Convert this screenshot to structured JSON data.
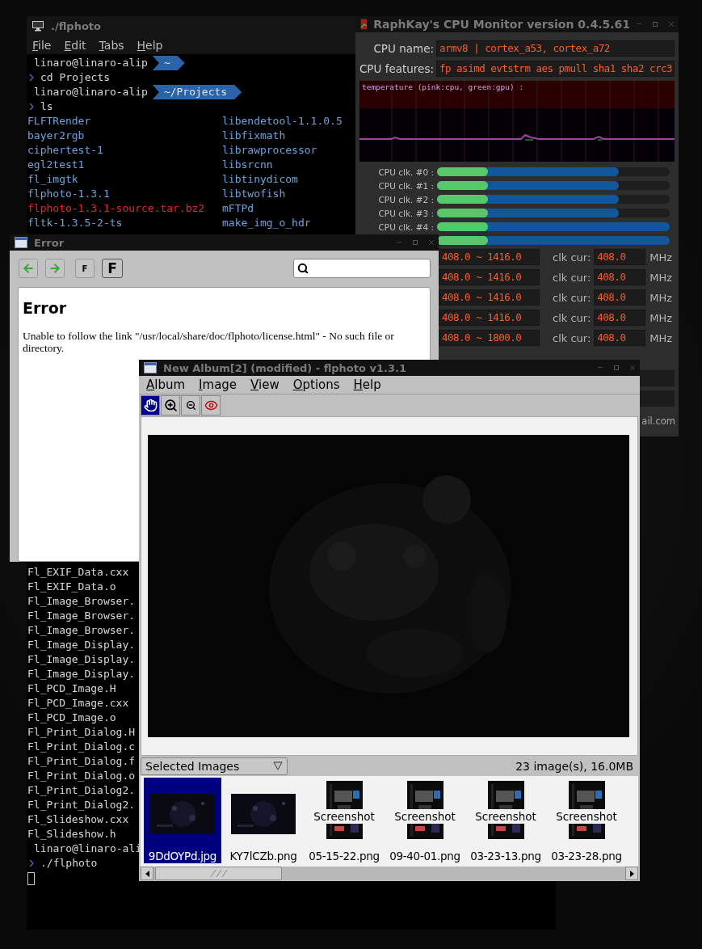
{
  "terminal": {
    "title": "./flphoto",
    "menu": [
      "File",
      "Edit",
      "Tabs",
      "Help"
    ],
    "session": [
      {
        "kind": "prompt",
        "user": "linaro@linaro-alip",
        "path": "~"
      },
      {
        "kind": "command",
        "text": "cd Projects"
      },
      {
        "kind": "prompt",
        "user": "linaro@linaro-alip",
        "path": "~/Projects"
      },
      {
        "kind": "command",
        "text": "ls"
      }
    ],
    "listing": [
      {
        "name": "FLFTRender",
        "kind": "dir"
      },
      {
        "name": "libendetool-1.1.0.5",
        "kind": "dir"
      },
      {
        "name": "bayer2rgb",
        "kind": "dir"
      },
      {
        "name": "libfixmath",
        "kind": "dir"
      },
      {
        "name": "ciphertest-1",
        "kind": "dir"
      },
      {
        "name": "librawprocessor",
        "kind": "dir"
      },
      {
        "name": "egl2test1",
        "kind": "dir"
      },
      {
        "name": "libsrcnn",
        "kind": "dir"
      },
      {
        "name": "fl_imgtk",
        "kind": "dir"
      },
      {
        "name": "libtinydicom",
        "kind": "dir"
      },
      {
        "name": "flphoto-1.3.1",
        "kind": "dir"
      },
      {
        "name": "libtwofish",
        "kind": "dir"
      },
      {
        "name": "flphoto-1.3.1-source.tar.bz2",
        "kind": "archive"
      },
      {
        "name": "mFTPd",
        "kind": "dir"
      },
      {
        "name": "fltk-1.3.5-2-ts",
        "kind": "dir"
      },
      {
        "name": "make_img_o_hdr",
        "kind": "dir"
      }
    ],
    "tail": [
      {
        "kind": "file",
        "text": "Fl_EXIF_Data.cxx"
      },
      {
        "kind": "file",
        "text": "Fl_EXIF_Data.o"
      },
      {
        "kind": "file",
        "text": "Fl_Image_Browser."
      },
      {
        "kind": "file",
        "text": "Fl_Image_Browser."
      },
      {
        "kind": "file",
        "text": "Fl_Image_Browser."
      },
      {
        "kind": "file",
        "text": "Fl_Image_Display."
      },
      {
        "kind": "file",
        "text": "Fl_Image_Display."
      },
      {
        "kind": "file",
        "text": "Fl_Image_Display."
      },
      {
        "kind": "file",
        "text": "Fl_PCD_Image.H"
      },
      {
        "kind": "file",
        "text": "Fl_PCD_Image.cxx"
      },
      {
        "kind": "file",
        "text": "Fl_PCD_Image.o"
      },
      {
        "kind": "file",
        "text": "Fl_Print_Dialog.H"
      },
      {
        "kind": "file",
        "text": "Fl_Print_Dialog.c"
      },
      {
        "kind": "file",
        "text": "Fl_Print_Dialog.f"
      },
      {
        "kind": "file",
        "text": "Fl_Print_Dialog.o"
      },
      {
        "kind": "file",
        "text": "Fl_Print_Dialog2."
      },
      {
        "kind": "file",
        "text": "Fl_Print_Dialog2."
      },
      {
        "kind": "file",
        "text": "Fl_Slideshow.cxx"
      },
      {
        "kind": "file",
        "text": "Fl_Slideshow.h"
      },
      {
        "kind": "prompt",
        "user": "linaro@linaro-ali"
      },
      {
        "kind": "command",
        "text": "./flphoto"
      }
    ]
  },
  "cpu_monitor": {
    "title": "RaphKay's CPU Monitor version 0.4.5.61",
    "fields": [
      {
        "label": "CPU name:",
        "value": "armv8 | cortex_a53, cortex_a72"
      },
      {
        "label": "CPU features:",
        "value": "fp asimd evtstrm aes pmull sha1 sha2 crc3"
      }
    ],
    "graph_label": "temperature (pink:cpu, green:gpu) :",
    "clocks": [
      {
        "label": "CPU clk. #0 :",
        "current": {
          "level": 0.22
        },
        "max": {
          "level": 0.78
        }
      },
      {
        "label": "CPU clk. #1 :",
        "current": {
          "level": 0.22
        },
        "max": {
          "level": 0.78
        }
      },
      {
        "label": "CPU clk. #2 :",
        "current": {
          "level": 0.22
        },
        "max": {
          "level": 0.78
        }
      },
      {
        "label": "CPU clk. #3 :",
        "current": {
          "level": 0.22
        },
        "max": {
          "level": 0.78
        }
      },
      {
        "label": "CPU clk. #4 :",
        "current": {
          "level": 0.22
        },
        "max": {
          "level": 1
        }
      },
      {
        "current": {
          "level": 0.22
        },
        "max": {
          "level": 1
        }
      }
    ],
    "frequencies": [
      {
        "range": "408.0 ~ 1416.0",
        "cur_label": "clk cur:",
        "cur": "408.0",
        "unit": "MHz"
      },
      {
        "range": "408.0 ~ 1416.0",
        "cur_label": "clk cur:",
        "cur": "408.0",
        "unit": "MHz"
      },
      {
        "range": "408.0 ~ 1416.0",
        "cur_label": "clk cur:",
        "cur": "408.0",
        "unit": "MHz"
      },
      {
        "range": "408.0 ~ 1416.0",
        "cur_label": "clk cur:",
        "cur": "408.0",
        "unit": "MHz"
      },
      {
        "range": "408.0 ~ 1800.0",
        "cur_label": "clk cur:",
        "cur": "408.0",
        "unit": "MHz"
      }
    ],
    "footer": "ail.com"
  },
  "error_window": {
    "title": "Error",
    "buttons": [
      {
        "kind": "back"
      },
      {
        "kind": "forward"
      },
      {
        "kind": "font_small",
        "label": "F"
      },
      {
        "kind": "font_large",
        "label": "F"
      }
    ],
    "heading": "Error",
    "message": "Unable to follow the link \"/usr/local/share/doc/flphoto/license.html\" - No such file or directory."
  },
  "flphoto": {
    "title": "New Album[2] (modified) - flphoto v1.3.1",
    "menu": [
      "Album",
      "Image",
      "View",
      "Options",
      "Help"
    ],
    "tools": [
      {
        "kind": "hand",
        "selected": true
      },
      {
        "kind": "zoom_in",
        "selected": false
      },
      {
        "kind": "zoom_out",
        "selected": false
      },
      {
        "kind": "eye",
        "selected": false
      }
    ],
    "filter": "Selected Images",
    "status": "23 image(s), 16.0MB",
    "thumbnails": [
      {
        "kind": "landscape",
        "caption": "9DdOYPd.jpg",
        "selected": true
      },
      {
        "kind": "landscape",
        "caption": "KY7lCZb.png",
        "selected": false
      },
      {
        "kind": "portrait",
        "label": "Screenshot",
        "caption": "05-15-22.png",
        "selected": false
      },
      {
        "kind": "portrait",
        "label": "Screenshot",
        "caption": "09-40-01.png",
        "selected": false
      },
      {
        "kind": "portrait",
        "label": "Screenshot",
        "caption": "03-23-13.png",
        "selected": false
      },
      {
        "kind": "portrait",
        "label": "Screenshot",
        "caption": "03-23-28.png",
        "selected": false
      }
    ]
  }
}
